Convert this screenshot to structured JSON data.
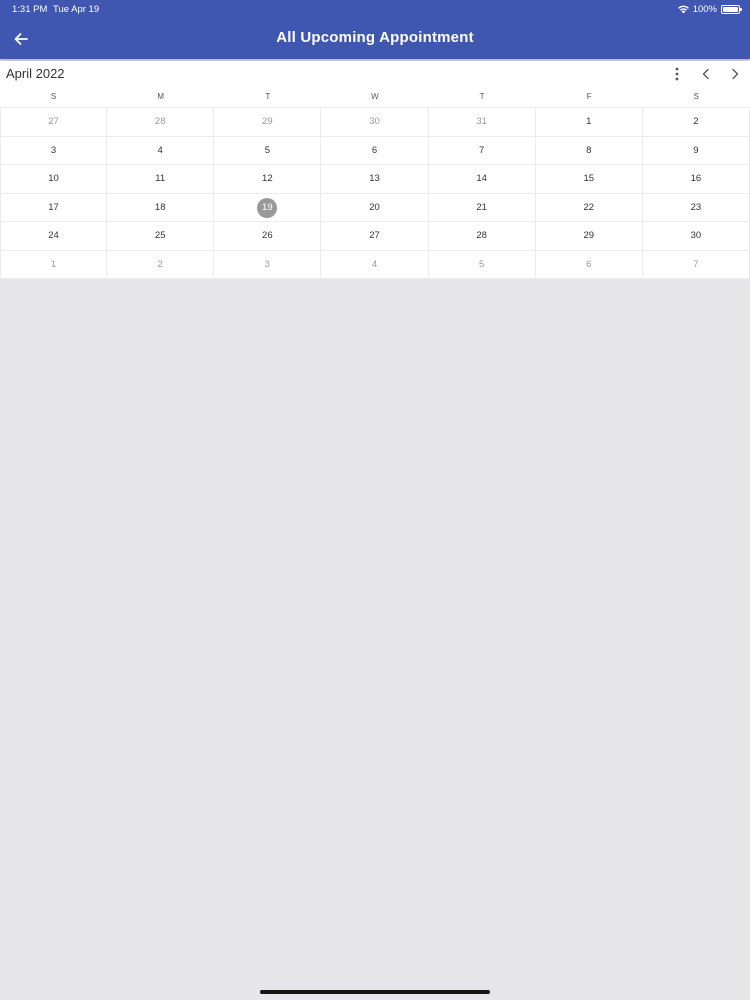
{
  "status_bar": {
    "time": "1:31 PM",
    "date": "Tue Apr 19",
    "battery": "100%"
  },
  "header": {
    "title": "All Upcoming Appointment",
    "back_icon": "arrow-left-icon"
  },
  "calendar": {
    "month_title": "April 2022",
    "weekdays": [
      "S",
      "M",
      "T",
      "W",
      "T",
      "F",
      "S"
    ],
    "days": [
      {
        "label": "27",
        "other": true
      },
      {
        "label": "28",
        "other": true
      },
      {
        "label": "29",
        "other": true
      },
      {
        "label": "30",
        "other": true
      },
      {
        "label": "31",
        "other": true
      },
      {
        "label": "1"
      },
      {
        "label": "2"
      },
      {
        "label": "3"
      },
      {
        "label": "4"
      },
      {
        "label": "5"
      },
      {
        "label": "6"
      },
      {
        "label": "7"
      },
      {
        "label": "8"
      },
      {
        "label": "9"
      },
      {
        "label": "10"
      },
      {
        "label": "11"
      },
      {
        "label": "12"
      },
      {
        "label": "13"
      },
      {
        "label": "14"
      },
      {
        "label": "15"
      },
      {
        "label": "16"
      },
      {
        "label": "17"
      },
      {
        "label": "18"
      },
      {
        "label": "19",
        "today": true
      },
      {
        "label": "20"
      },
      {
        "label": "21"
      },
      {
        "label": "22"
      },
      {
        "label": "23"
      },
      {
        "label": "24"
      },
      {
        "label": "25"
      },
      {
        "label": "26"
      },
      {
        "label": "27"
      },
      {
        "label": "28"
      },
      {
        "label": "29"
      },
      {
        "label": "30"
      },
      {
        "label": "1",
        "other": true
      },
      {
        "label": "2",
        "other": true
      },
      {
        "label": "3",
        "other": true
      },
      {
        "label": "4",
        "other": true
      },
      {
        "label": "5",
        "other": true
      },
      {
        "label": "6",
        "other": true
      },
      {
        "label": "7",
        "other": true
      }
    ]
  },
  "colors": {
    "header_bg": "#3f57b0",
    "today_bg": "#999999",
    "page_bg": "#e6e6e9"
  }
}
